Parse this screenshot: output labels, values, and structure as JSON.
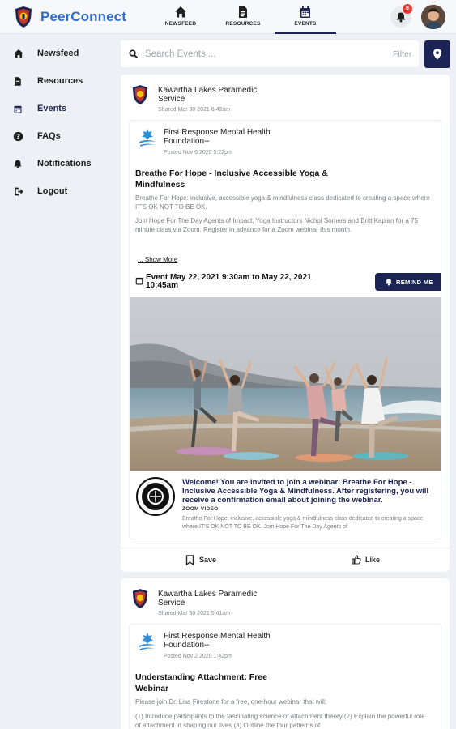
{
  "app": {
    "brand": "PeerConnect"
  },
  "nav": {
    "tabs": [
      {
        "label": "NEWSFEED",
        "icon": "home-icon"
      },
      {
        "label": "RESOURCES",
        "icon": "document-icon"
      },
      {
        "label": "EVENTS",
        "icon": "calendar-icon",
        "active": true
      }
    ],
    "notification_count": "8"
  },
  "sidebar": {
    "items": [
      {
        "label": "Newsfeed",
        "icon": "home-icon"
      },
      {
        "label": "Resources",
        "icon": "document-icon"
      },
      {
        "label": "Events",
        "icon": "calendar-icon",
        "active": true
      },
      {
        "label": "FAQs",
        "icon": "question-icon"
      },
      {
        "label": "Notifications",
        "icon": "bell-icon"
      },
      {
        "label": "Logout",
        "icon": "logout-icon"
      }
    ]
  },
  "search": {
    "placeholder": "Search Events ...",
    "filter_label": "Filter"
  },
  "posts": [
    {
      "org_name": "Kawartha Lakes Paramedic Service",
      "shared": "Shared Mar 30 2021 6:42am",
      "source_name": "First Response Mental Health Foundation--",
      "source_posted": "Posted Nov 6 2020 5:22pm",
      "title": "Breathe For Hope - Inclusive Accessible Yoga & Mindfulness",
      "desc_1": "Breathe For Hope: inclusive, accessible yoga & mindfulness class dedicated to creating a space where IT'S OK NOT TO BE OK.",
      "desc_2": "Join Hope For The Day Agents of Impact, Yoga Instructors Nichol Somers and Britt Kaplan for a 75 minute class via Zoom. Register in advance for a Zoom webinar this month.",
      "show_more": "... Show More",
      "event_date": "Event May 22, 2021 9:30am to May 22, 2021 10:45am",
      "remind_label": "REMIND ME",
      "webinar_title": "Welcome! You are invited to join a webinar: Breathe For Hope - Inclusive Accessible Yoga & Mindfulness. After registering, you will receive a confirmation email about joining the webinar.",
      "webinar_tag": "ZOOM VIDEO",
      "webinar_desc": "Breathe For Hope: inclusive, accessible yoga & mindfulness class dedicated to creating a space where IT'S OK NOT TO BE OK. Join Hope For The Day Agents of",
      "save_label": "Save",
      "like_label": "Like"
    },
    {
      "org_name": "Kawartha Lakes Paramedic Service",
      "shared": "Shared Mar 30 2021 5:41am",
      "source_name": "First Response Mental Health Foundation--",
      "source_posted": "Posted Nov 2 2020 1:42pm",
      "title": "Understanding Attachment: Free Webinar",
      "desc_1": "Please join Dr. Lisa Firestone for a free, one-hour webinar that will:",
      "desc_2": "(1) Introduce participants to the fascinating science of attachment theory (2) Explain the powerful role of attachment in shaping our lives (3) Outline the four patterns of"
    }
  ],
  "colors": {
    "brand": "#2f6bc6",
    "navy": "#1b2454",
    "badge": "#e53935"
  }
}
